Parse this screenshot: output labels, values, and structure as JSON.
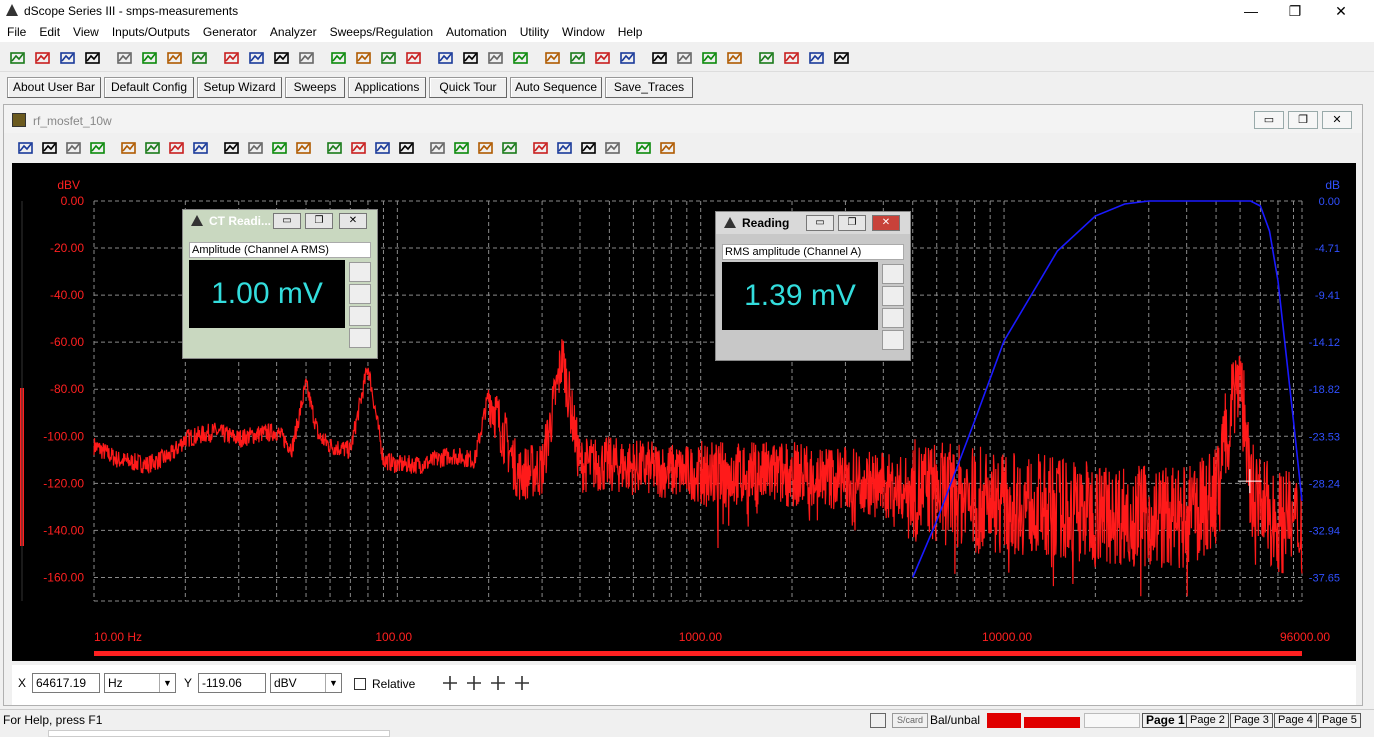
{
  "app": {
    "title": "dScope Series III - smps-measurements"
  },
  "menu": [
    "File",
    "Edit",
    "View",
    "Inputs/Outputs",
    "Generator",
    "Analyzer",
    "Sweeps/Regulation",
    "Automation",
    "Utility",
    "Window",
    "Help"
  ],
  "toolbar_buttons": [
    "open-icon",
    "save-icon",
    "save-as-icon",
    "generator-off-icon",
    "generator-on-icon",
    "output-off-icon",
    "output-on-icon",
    "input-off-icon",
    "input-on-icon",
    "clear-icon",
    "filter-icon",
    "analyzer-icon",
    "meter-icon",
    "meter2-icon",
    "scope-icon",
    "scope2-icon",
    "fft-icon",
    "fft2-icon",
    "play-icon",
    "record-icon",
    "sweep-icon",
    "sweep2-icon",
    "sweep3-icon",
    "sweep4-icon",
    "graph-icon",
    "forward-icon",
    "regulation-icon",
    "settings-icon",
    "clock-icon",
    "script-icon",
    "script2-icon",
    "help-icon"
  ],
  "user_bar": [
    "About User Bar",
    "Default Config",
    "Setup Wizard",
    "Sweeps",
    "Applications",
    "Quick Tour",
    "Auto Sequence",
    "Save_Traces"
  ],
  "child_window": {
    "title": "rf_mosfet_10w"
  },
  "graph_toolbar": [
    "cursor-add-icon",
    "trace-icon",
    "save-trace-icon",
    "copy-icon",
    "graph-view-icon",
    "graph-view2-icon",
    "graph-props-icon",
    "limits-icon",
    "zoom-icon",
    "zoom-out-icon",
    "fit-icon",
    "peak-left-icon",
    "peak-icon",
    "peak-right-icon",
    "peak-next-icon",
    "scale-icon",
    "scale2-icon",
    "scale3-icon",
    "marker-icon",
    "marker-up-icon",
    "marker-down-icon",
    "cursor-icon",
    "cursor2-icon",
    "link-icon",
    "link2-icon",
    "link3-icon"
  ],
  "chart_data": {
    "type": "line",
    "xscale": "log",
    "xlim": [
      10,
      96000
    ],
    "x_ticks": [
      "10.00 Hz",
      "100.00",
      "1000.00",
      "10000.00",
      "96000.00"
    ],
    "ylabel_left": "dBV",
    "ylabel_right": "dB",
    "ylim": [
      -170,
      0
    ],
    "y_ticks_left": [
      "0.00",
      "-20.00",
      "-40.00",
      "-60.00",
      "-80.00",
      "-100.00",
      "-120.00",
      "-140.00",
      "-160.00"
    ],
    "y_ticks_right": [
      "0.00",
      "-4.71",
      "-9.41",
      "-14.12",
      "-18.82",
      "-23.53",
      "-28.24",
      "-32.94",
      "-37.65"
    ],
    "grid": true,
    "series": [
      {
        "color": "#ff1a1a",
        "x": [
          10,
          12,
          15,
          18,
          20,
          25,
          30,
          35,
          40,
          45,
          50,
          55,
          60,
          70,
          80,
          90,
          100,
          120,
          150,
          180,
          200,
          250,
          300,
          350,
          400,
          500,
          700,
          1000,
          2000,
          3000,
          5000,
          8000,
          10000,
          15000,
          20000,
          30000,
          40000,
          50000,
          55000,
          60000,
          64617,
          70000,
          80000,
          96000
        ],
        "y": [
          -104,
          -110,
          -112,
          -108,
          -101,
          -98,
          -101,
          -99,
          -98,
          -105,
          -78,
          -100,
          -104,
          -106,
          -70,
          -110,
          -112,
          -112,
          -108,
          -110,
          -82,
          -116,
          -114,
          -66,
          -112,
          -112,
          -114,
          -116,
          -116,
          -118,
          -123,
          -126,
          -128,
          -130,
          -132,
          -134,
          -135,
          -126,
          -90,
          -71,
          -119,
          -130,
          -136,
          -138
        ]
      },
      {
        "color": "#1a1aff",
        "x": [
          5000,
          6000,
          8000,
          10000,
          15000,
          20000,
          25000,
          30000,
          40000,
          50000,
          60000,
          65000,
          70000,
          75000,
          80000,
          90000,
          96000
        ],
        "y": [
          -37.65,
          -32,
          -22,
          -14,
          -5,
          -1.5,
          -0.3,
          0,
          0,
          0,
          0,
          0,
          -0.5,
          -3,
          -8,
          -22,
          -30
        ]
      }
    ]
  },
  "reading1": {
    "title": "CT Readi...",
    "label": "Amplitude (Channel A RMS)",
    "value": "1.00 mV"
  },
  "reading2": {
    "title": "Reading",
    "label": "RMS amplitude (Channel A)",
    "value": "1.39 mV"
  },
  "cursor": {
    "x_label": "X",
    "x_value": "64617.19",
    "x_unit": "Hz",
    "y_label": "Y",
    "y_value": "-119.06",
    "y_unit": "dBV",
    "relative_label": "Relative"
  },
  "status": {
    "help": "For Help, press F1",
    "scard": "S/card",
    "balunbal": "Bal/unbal",
    "pages": [
      "Page 1",
      "Page 2",
      "Page 3",
      "Page 4",
      "Page 5"
    ]
  }
}
